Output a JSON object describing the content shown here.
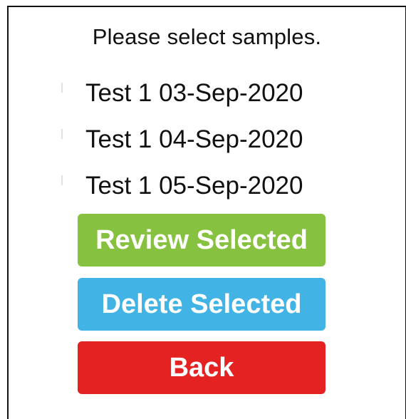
{
  "prompt": "Please select samples.",
  "samples": [
    {
      "label": "Test 1 03-Sep-2020"
    },
    {
      "label": "Test 1 04-Sep-2020"
    },
    {
      "label": "Test 1 05-Sep-2020"
    }
  ],
  "buttons": {
    "review": {
      "label": "Review Selected",
      "color": "#86c23f"
    },
    "delete": {
      "label": "Delete Selected",
      "color": "#41b3e4"
    },
    "back": {
      "label": "Back",
      "color": "#e42222"
    }
  }
}
